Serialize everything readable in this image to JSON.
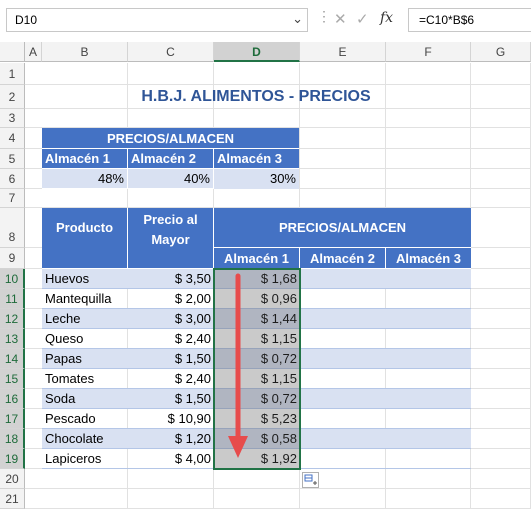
{
  "formula_bar": {
    "name_box": "D10",
    "formula": "=C10*B$6",
    "icons": [
      "cancel-icon",
      "enter-icon",
      "function-icon"
    ],
    "fx_label": "fx"
  },
  "columns": [
    "A",
    "B",
    "C",
    "D",
    "E",
    "F",
    "G"
  ],
  "rows": [
    "1",
    "2",
    "3",
    "4",
    "5",
    "6",
    "7",
    "8",
    "9",
    "10",
    "11",
    "12",
    "13",
    "14",
    "15",
    "16",
    "17",
    "18",
    "19",
    "20",
    "21"
  ],
  "title": "H.B.J. ALIMENTOS - PRECIOS",
  "top_table": {
    "header": "PRECIOS/ALMACEN",
    "stores": [
      "Almacén 1",
      "Almacén 2",
      "Almacén 3"
    ],
    "percentages": [
      "48%",
      "40%",
      "30%"
    ]
  },
  "main_table": {
    "col_producto": "Producto",
    "col_precio_l1": "Precio al",
    "col_precio_l2": "Mayor",
    "col_precios": "PRECIOS/ALMACEN",
    "stores": [
      "Almacén 1",
      "Almacén 2",
      "Almacén 3"
    ],
    "currency": "$",
    "products": [
      "Huevos",
      "Mantequilla",
      "Leche",
      "Queso",
      "Papas",
      "Tomates",
      "Soda",
      "Pescado",
      "Chocolate",
      "Lapiceros"
    ],
    "prices": [
      "3,50",
      "2,00",
      "3,00",
      "2,40",
      "1,50",
      "2,40",
      "1,50",
      "10,90",
      "1,20",
      "4,00"
    ],
    "store1": [
      "1,68",
      "0,96",
      "1,44",
      "1,15",
      "0,72",
      "1,15",
      "0,72",
      "5,23",
      "0,58",
      "1,92"
    ]
  },
  "colors": {
    "header_blue": "#4472c4",
    "light_band": "#d9e1f2",
    "title_blue": "#2f5597",
    "selection_green": "#217346",
    "arrow_red": "#e74c4c"
  }
}
